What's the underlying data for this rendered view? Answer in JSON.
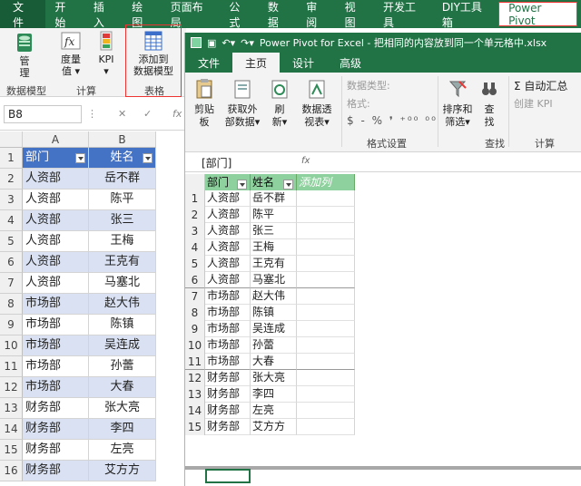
{
  "excel": {
    "tabs": [
      "文件",
      "开始",
      "插入",
      "绘图",
      "页面布局",
      "公式",
      "数据",
      "审阅",
      "视图",
      "开发工具",
      "DIY工具箱"
    ],
    "pp_tab": "Power Pivot",
    "ribbon": {
      "manage_line1": "管",
      "manage_line2": "理",
      "measure_line1": "度量",
      "measure_line2": "值",
      "kpi": "KPI",
      "add_line1": "添加到",
      "add_line2": "数据模型",
      "group_datamodel": "数据模型",
      "group_calc": "计算",
      "group_table": "表格"
    },
    "name_box": "B8",
    "fx": "fx",
    "columns": [
      "A",
      "B"
    ],
    "header": {
      "a": "部门",
      "b": "姓名"
    },
    "rows": [
      {
        "n": "1",
        "a": "部门",
        "b": "姓名"
      },
      {
        "n": "2",
        "a": "人资部",
        "b": "岳不群"
      },
      {
        "n": "3",
        "a": "人资部",
        "b": "陈平"
      },
      {
        "n": "4",
        "a": "人资部",
        "b": "张三"
      },
      {
        "n": "5",
        "a": "人资部",
        "b": "王梅"
      },
      {
        "n": "6",
        "a": "人资部",
        "b": "王克有"
      },
      {
        "n": "7",
        "a": "人资部",
        "b": "马塞北"
      },
      {
        "n": "8",
        "a": "市场部",
        "b": "赵大伟"
      },
      {
        "n": "9",
        "a": "市场部",
        "b": "陈镇"
      },
      {
        "n": "10",
        "a": "市场部",
        "b": "吴连成"
      },
      {
        "n": "11",
        "a": "市场部",
        "b": "孙蕾"
      },
      {
        "n": "12",
        "a": "市场部",
        "b": "大春"
      },
      {
        "n": "13",
        "a": "财务部",
        "b": "张大亮"
      },
      {
        "n": "14",
        "a": "财务部",
        "b": "李四"
      },
      {
        "n": "15",
        "a": "财务部",
        "b": "左亮"
      },
      {
        "n": "16",
        "a": "财务部",
        "b": "艾方方"
      }
    ]
  },
  "powerpivot": {
    "title": "Power Pivot for Excel - 把相同的内容放到同一个单元格中.xlsx",
    "tabs": [
      "文件",
      "主页",
      "设计",
      "高级"
    ],
    "ribbon": {
      "paste": "剪贴板",
      "get_ext_line1": "获取外",
      "get_ext_line2": "部数据",
      "refresh_line1": "刷",
      "refresh_line2": "新",
      "pivot_line1": "数据透",
      "pivot_line2": "视表",
      "datatype": "数据类型:",
      "format": "格式:",
      "fmt_symbols": "$ - % ❜ ⁺⁰⁰ ⁰⁰",
      "group_format": "格式设置",
      "sort_line1": "排序和",
      "sort_line2": "筛选",
      "find_line1": "查",
      "find_line2": "找",
      "group_find": "查找",
      "autosum": "Σ 自动汇总",
      "create_kpi": "创建 KPI",
      "group_calc": "计算"
    },
    "formula_name": "[部门]",
    "formula_fx": "fx",
    "headers": [
      "部门",
      "姓名",
      "添加列"
    ],
    "rows": [
      {
        "n": "1",
        "a": "人资部",
        "b": "岳不群"
      },
      {
        "n": "2",
        "a": "人资部",
        "b": "陈平"
      },
      {
        "n": "3",
        "a": "人资部",
        "b": "张三"
      },
      {
        "n": "4",
        "a": "人资部",
        "b": "王梅"
      },
      {
        "n": "5",
        "a": "人资部",
        "b": "王克有"
      },
      {
        "n": "6",
        "a": "人资部",
        "b": "马塞北"
      },
      {
        "n": "7",
        "a": "市场部",
        "b": "赵大伟"
      },
      {
        "n": "8",
        "a": "市场部",
        "b": "陈镇"
      },
      {
        "n": "9",
        "a": "市场部",
        "b": "吴连成"
      },
      {
        "n": "10",
        "a": "市场部",
        "b": "孙蕾"
      },
      {
        "n": "11",
        "a": "市场部",
        "b": "大春"
      },
      {
        "n": "12",
        "a": "财务部",
        "b": "张大亮"
      },
      {
        "n": "13",
        "a": "财务部",
        "b": "李四"
      },
      {
        "n": "14",
        "a": "财务部",
        "b": "左亮"
      },
      {
        "n": "15",
        "a": "财务部",
        "b": "艾方方"
      }
    ]
  },
  "colors": {
    "excel_green": "#217346",
    "table_blue": "#4472c4",
    "band": "#d9e1f2",
    "pp_header": "#8fd19e",
    "highlight": "#ee3333"
  }
}
